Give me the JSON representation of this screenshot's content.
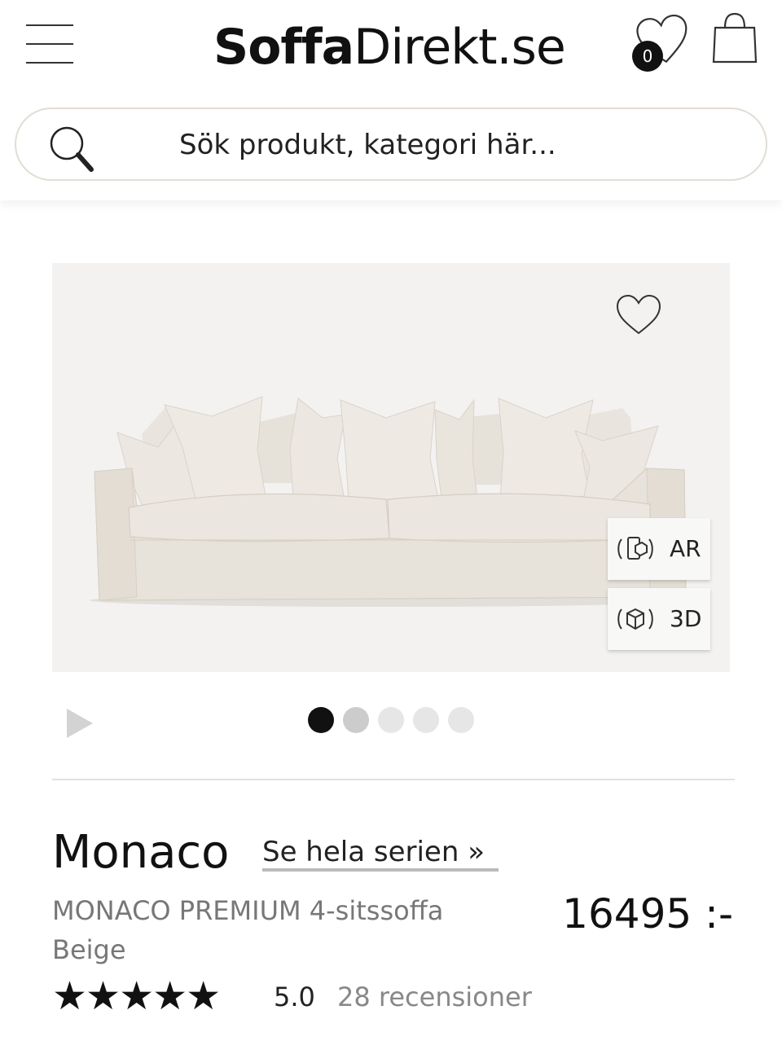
{
  "header": {
    "logo_bold": "Soffa",
    "logo_rest": "Direkt.se",
    "wishlist_count": "0",
    "icons": {
      "menu": "hamburger-icon",
      "wishlist": "heart-icon",
      "cart": "shopping-bag-icon"
    }
  },
  "search": {
    "placeholder": "Sök produkt, kategori här...",
    "icon": "search-icon"
  },
  "gallery": {
    "view_buttons": [
      {
        "label": "AR",
        "icon": "ar-phone-icon"
      },
      {
        "label": "3D",
        "icon": "3d-cube-icon"
      }
    ],
    "favorite_icon": "heart-icon",
    "play_icon": "play-icon",
    "slide_count": 5,
    "active_slide": 1,
    "dot_colors": [
      "#111111",
      "#cccccc",
      "#e6e6e6",
      "#e6e6e6",
      "#e6e6e6"
    ]
  },
  "product": {
    "title": "Monaco",
    "series_link": "Se hela serien »",
    "subtitle_line1": "MONACO PREMIUM 4-sitssoffa",
    "subtitle_line2": "Beige",
    "price": "16495 :-",
    "stars": "★★★★★",
    "rating_value": "5.0",
    "reviews": "28 recensioner"
  },
  "colors": {
    "text": "#111111",
    "muted": "#777777",
    "border": "#e2ddd5",
    "image_bg": "#f3f2f0",
    "sofa": "#e7e2da"
  }
}
